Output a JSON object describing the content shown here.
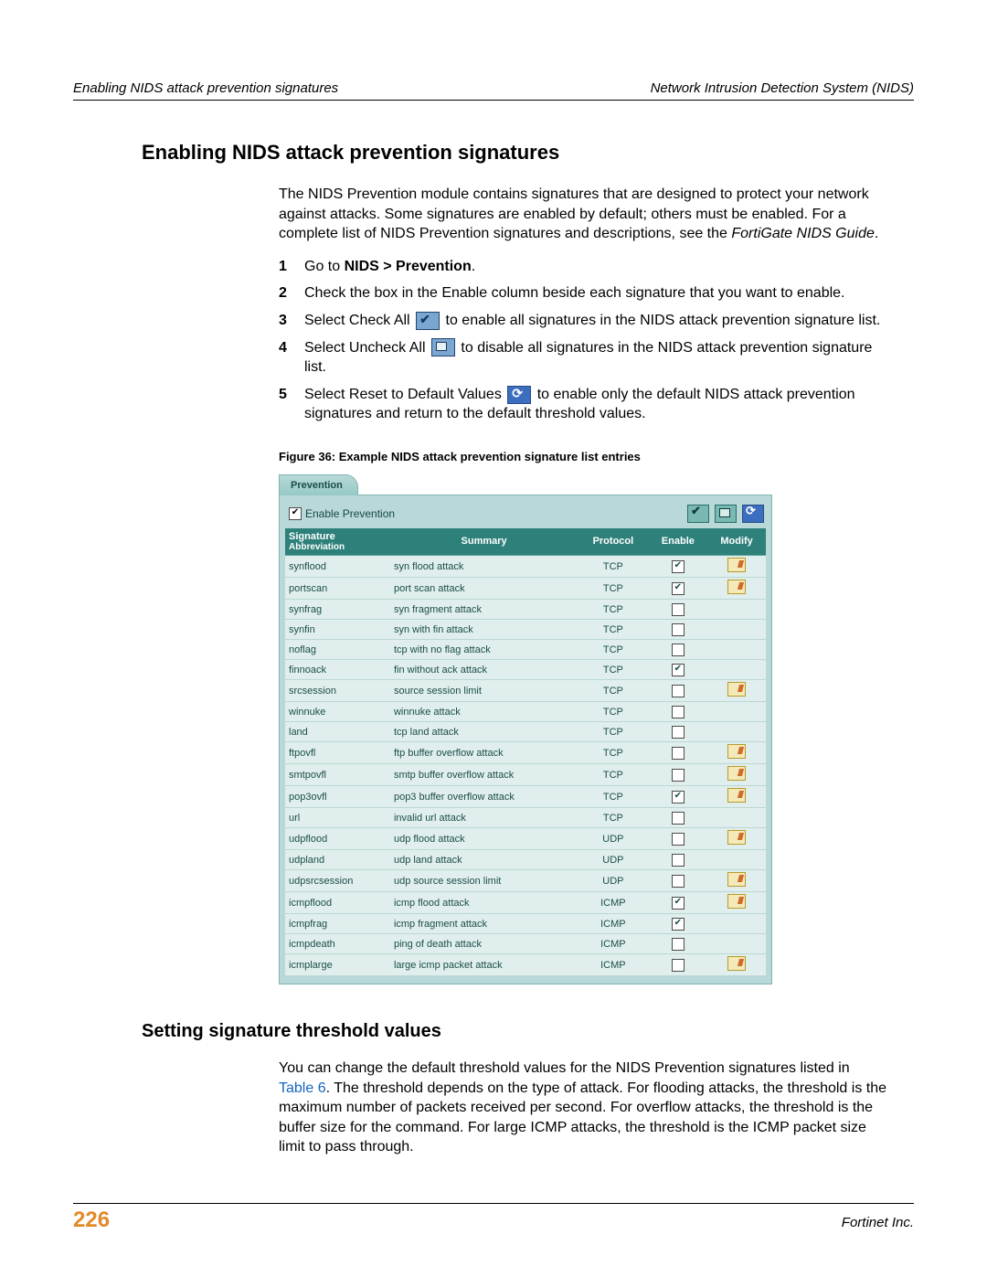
{
  "header": {
    "left": "Enabling NIDS attack prevention signatures",
    "right": "Network Intrusion Detection System (NIDS)"
  },
  "title1": "Enabling NIDS attack prevention signatures",
  "intro": "The NIDS Prevention module contains signatures that are designed to protect your network against attacks. Some signatures are enabled by default; others must be enabled. For a complete list of NIDS Prevention signatures and descriptions, see the ",
  "intro_em": "FortiGate NIDS Guide",
  "steps": [
    {
      "n": "1",
      "pre": "Go to ",
      "bold": "NIDS > Prevention",
      "post": "."
    },
    {
      "n": "2",
      "text": "Check the box in the Enable column beside each signature that you want to enable."
    },
    {
      "n": "3",
      "pre": "Select Check All ",
      "icon": "check",
      "post": " to enable all signatures in the NIDS attack prevention signature list."
    },
    {
      "n": "4",
      "pre": "Select Uncheck All ",
      "icon": "uncheck",
      "post": " to disable all signatures in the NIDS attack prevention signature list."
    },
    {
      "n": "5",
      "pre": "Select Reset to Default Values ",
      "icon": "reset",
      "post": " to enable only the default NIDS attack prevention signatures and return to the default threshold values."
    }
  ],
  "fig_caption": "Figure 36: Example NIDS attack prevention signature list entries",
  "forti": {
    "tab": "Prevention",
    "enable_label": "Enable Prevention",
    "cols": {
      "sig": "Signature",
      "sig2": "Abbreviation",
      "sum": "Summary",
      "proto": "Protocol",
      "en": "Enable",
      "mod": "Modify"
    },
    "rows": [
      {
        "a": "synflood",
        "s": "syn flood attack",
        "p": "TCP",
        "e": true,
        "m": true
      },
      {
        "a": "portscan",
        "s": "port scan attack",
        "p": "TCP",
        "e": true,
        "m": true
      },
      {
        "a": "synfrag",
        "s": "syn fragment attack",
        "p": "TCP",
        "e": false,
        "m": false
      },
      {
        "a": "synfin",
        "s": "syn with fin attack",
        "p": "TCP",
        "e": false,
        "m": false
      },
      {
        "a": "noflag",
        "s": "tcp with no flag attack",
        "p": "TCP",
        "e": false,
        "m": false
      },
      {
        "a": "finnoack",
        "s": "fin without ack attack",
        "p": "TCP",
        "e": true,
        "m": false
      },
      {
        "a": "srcsession",
        "s": "source session limit",
        "p": "TCP",
        "e": false,
        "m": true
      },
      {
        "a": "winnuke",
        "s": "winnuke attack",
        "p": "TCP",
        "e": false,
        "m": false
      },
      {
        "a": "land",
        "s": "tcp land attack",
        "p": "TCP",
        "e": false,
        "m": false
      },
      {
        "a": "ftpovfl",
        "s": "ftp buffer overflow attack",
        "p": "TCP",
        "e": false,
        "m": true
      },
      {
        "a": "smtpovfl",
        "s": "smtp buffer overflow attack",
        "p": "TCP",
        "e": false,
        "m": true
      },
      {
        "a": "pop3ovfl",
        "s": "pop3 buffer overflow attack",
        "p": "TCP",
        "e": true,
        "m": true
      },
      {
        "a": "url",
        "s": "invalid url attack",
        "p": "TCP",
        "e": false,
        "m": false
      },
      {
        "a": "udpflood",
        "s": "udp flood attack",
        "p": "UDP",
        "e": false,
        "m": true
      },
      {
        "a": "udpland",
        "s": "udp land attack",
        "p": "UDP",
        "e": false,
        "m": false
      },
      {
        "a": "udpsrcsession",
        "s": "udp source session limit",
        "p": "UDP",
        "e": false,
        "m": true
      },
      {
        "a": "icmpflood",
        "s": "icmp flood attack",
        "p": "ICMP",
        "e": true,
        "m": true
      },
      {
        "a": "icmpfrag",
        "s": "icmp fragment attack",
        "p": "ICMP",
        "e": true,
        "m": false
      },
      {
        "a": "icmpdeath",
        "s": "ping of death attack",
        "p": "ICMP",
        "e": false,
        "m": false
      },
      {
        "a": "icmplarge",
        "s": "large icmp packet attack",
        "p": "ICMP",
        "e": false,
        "m": true
      }
    ]
  },
  "title2": "Setting signature threshold values",
  "para2_a": "You can change the default threshold values for the NIDS Prevention signatures listed in ",
  "para2_link": "Table 6",
  "para2_b": ". The threshold depends on the type of attack. For flooding attacks, the threshold is the maximum number of packets received per second. For overflow attacks, the threshold is the buffer size for the command. For large ICMP attacks, the threshold is the ICMP packet size limit to pass through.",
  "footer": {
    "page": "226",
    "company": "Fortinet Inc."
  }
}
